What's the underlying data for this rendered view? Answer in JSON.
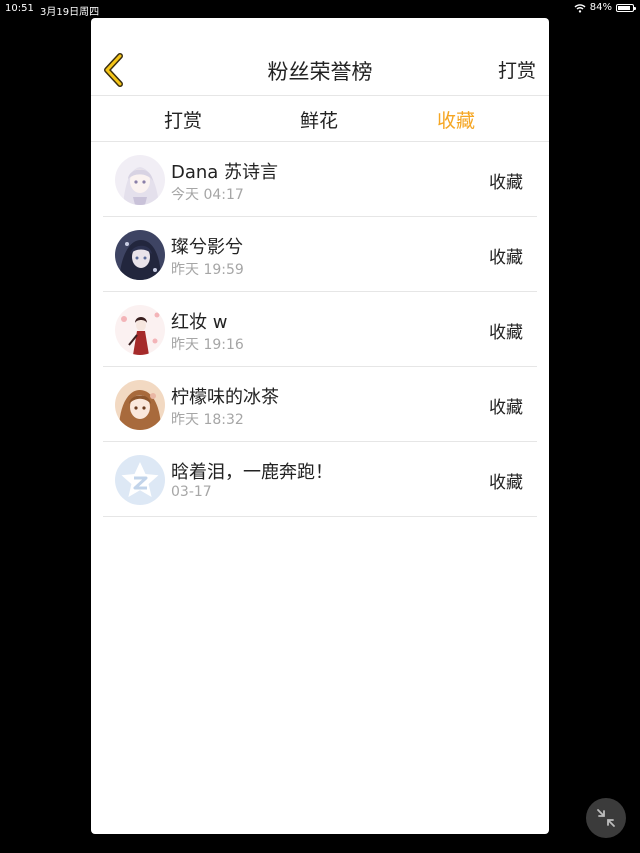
{
  "status_bar": {
    "time": "10:51",
    "date": "3月19日周四",
    "battery_percent": "84%",
    "battery_level": 0.84
  },
  "nav": {
    "title": "粉丝荣誉榜",
    "action_label": "打赏",
    "back_icon": "chevron-left-icon",
    "accent_color": "#f5a623"
  },
  "tabs": [
    {
      "label": "打赏",
      "active": false
    },
    {
      "label": "鲜花",
      "active": false
    },
    {
      "label": "收藏",
      "active": true
    }
  ],
  "fans": [
    {
      "name": "Dana 苏诗言",
      "time": "今天 04:17",
      "action": "收藏",
      "avatar": "anime-avatar-white-hair"
    },
    {
      "name": "璨兮影兮",
      "time": "昨天 19:59",
      "action": "收藏",
      "avatar": "anime-avatar-dark-hair"
    },
    {
      "name": "红妆 w",
      "time": "昨天 19:16",
      "action": "收藏",
      "avatar": "anime-avatar-red-kimono"
    },
    {
      "name": "柠檬味的冰茶",
      "time": "昨天 18:32",
      "action": "收藏",
      "avatar": "anime-avatar-brown-hair"
    },
    {
      "name": "晗着泪，一鹿奔跑！",
      "time": "03-17",
      "action": "收藏",
      "avatar": "default-avatar-star"
    }
  ],
  "floating_button_icon": "collapse-arrows-icon"
}
